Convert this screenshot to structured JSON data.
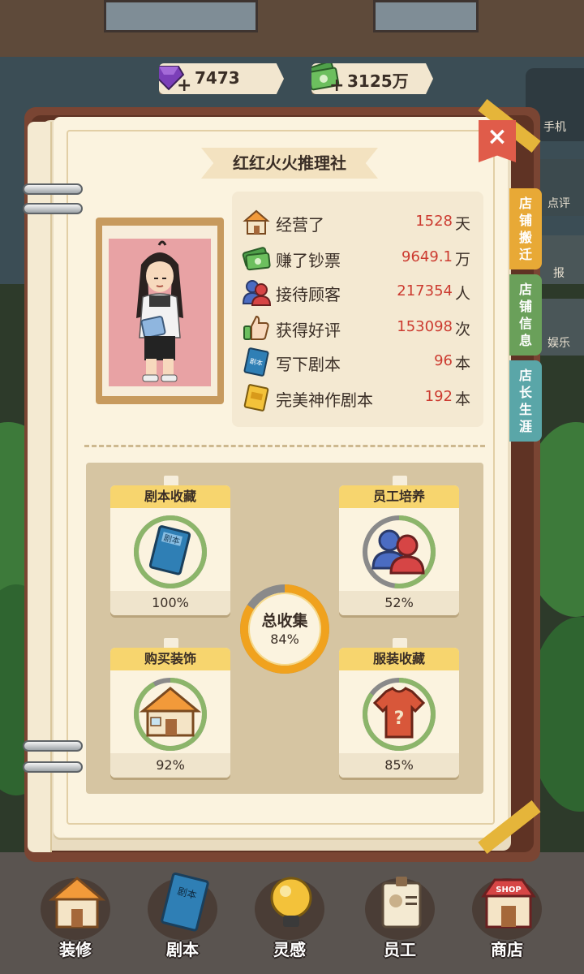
{
  "currency": {
    "gems": "7473",
    "cash": "3125万",
    "plus": "+"
  },
  "side_hud": {
    "phone": "手机",
    "review": "点评",
    "entertain": "娱乐",
    "report": "报"
  },
  "book": {
    "title": "红红火火推理社",
    "close": "×"
  },
  "tabs": [
    {
      "chars": [
        "店",
        "铺",
        "搬",
        "迁"
      ],
      "color": "#e8a936"
    },
    {
      "chars": [
        "店",
        "铺",
        "信",
        "息"
      ],
      "color": "#6aa05a"
    },
    {
      "chars": [
        "店",
        "长",
        "生",
        "涯"
      ],
      "color": "#5aa6a8"
    }
  ],
  "stats": [
    {
      "icon": "shop-icon",
      "label": "经营了",
      "value": "1528",
      "unit": "天"
    },
    {
      "icon": "money-icon",
      "label": "赚了钞票",
      "value": "9649.1",
      "unit": "万"
    },
    {
      "icon": "customers-icon",
      "label": "接待顾客",
      "value": "217354",
      "unit": "人"
    },
    {
      "icon": "thumbs-up-icon",
      "label": "获得好评",
      "value": "153098",
      "unit": "次"
    },
    {
      "icon": "script-book-icon",
      "label": "写下剧本",
      "value": "96",
      "unit": "本"
    },
    {
      "icon": "gold-book-icon",
      "label": "完美神作剧本",
      "value": "192",
      "unit": "本"
    }
  ],
  "collections": [
    {
      "title": "剧本收藏",
      "percent": "100%",
      "progress": 1.0,
      "icon": "script-book-icon"
    },
    {
      "title": "员工培养",
      "percent": "52%",
      "progress": 0.52,
      "icon": "staff-icon"
    },
    {
      "title": "购买装饰",
      "percent": "92%",
      "progress": 0.92,
      "icon": "shop-decor-icon"
    },
    {
      "title": "服装收藏",
      "percent": "85%",
      "progress": 0.85,
      "icon": "shirt-icon"
    }
  ],
  "total": {
    "label": "总收集",
    "percent": "84%",
    "progress": 0.84
  },
  "nav": [
    {
      "label": "装修",
      "icon": "decorate-icon"
    },
    {
      "label": "剧本",
      "icon": "script-icon"
    },
    {
      "label": "灵感",
      "icon": "lightbulb-icon"
    },
    {
      "label": "员工",
      "icon": "staff-card-icon"
    },
    {
      "label": "商店",
      "icon": "shop-icon"
    }
  ],
  "icon_text": {
    "script": "剧本",
    "shop": "SHOP",
    "question": "?"
  },
  "colors": {
    "value_red": "#cc3b30",
    "ring_green": "#8cb56a",
    "ring_orange": "#f0a21e",
    "ring_grey": "#8a8a8a",
    "card_header": "#f7d56e",
    "close_red": "#e05c4a"
  }
}
